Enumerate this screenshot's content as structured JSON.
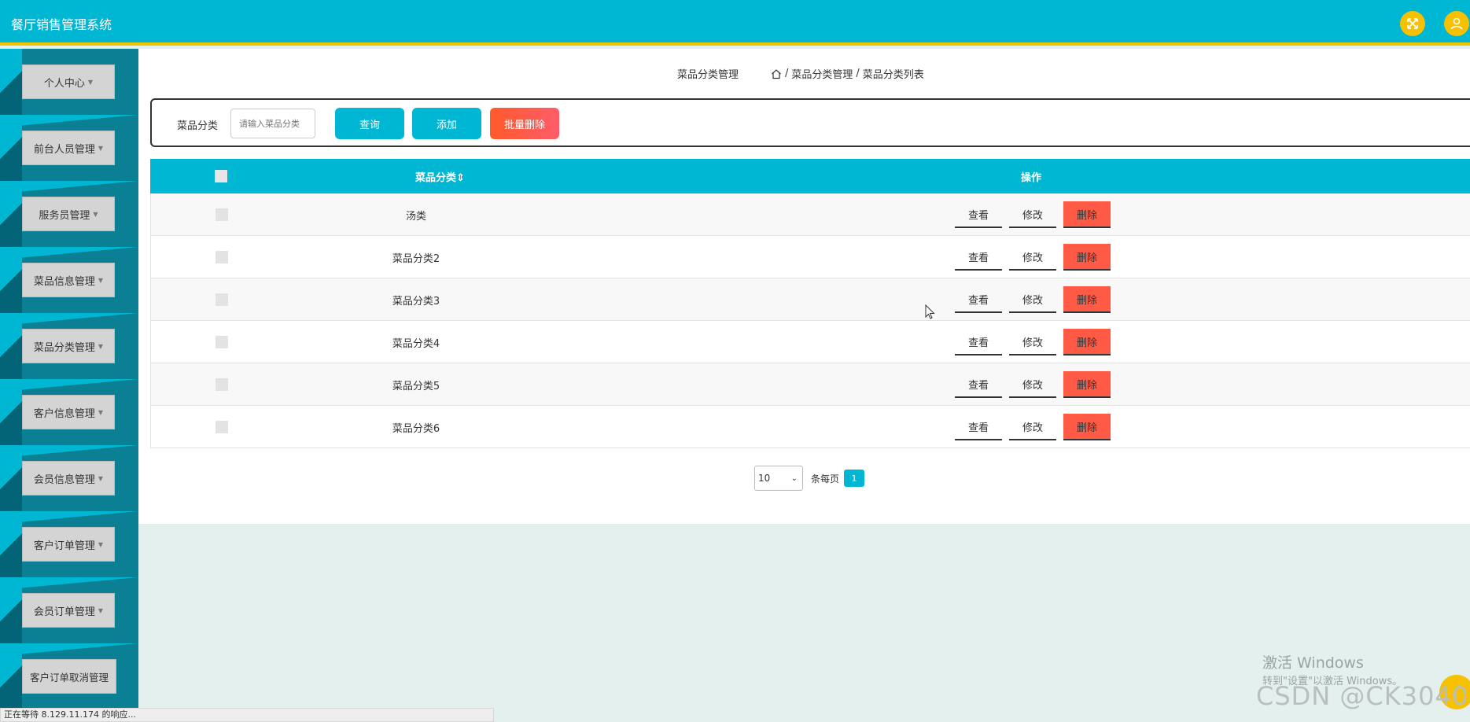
{
  "header": {
    "title": "餐厅销售管理系统",
    "accent_color": "#00b7d3",
    "border_color": "#f2c300",
    "icons": [
      "fullscreen-icon",
      "user-icon"
    ]
  },
  "sidebar": {
    "items": [
      {
        "label": "个人中心"
      },
      {
        "label": "前台人员管理"
      },
      {
        "label": "服务员管理"
      },
      {
        "label": "菜品信息管理"
      },
      {
        "label": "菜品分类管理"
      },
      {
        "label": "客户信息管理"
      },
      {
        "label": "会员信息管理"
      },
      {
        "label": "客户订单管理"
      },
      {
        "label": "会员订单管理"
      },
      {
        "label": "客户订单取消管理"
      }
    ]
  },
  "page": {
    "title": "菜品分类管理",
    "breadcrumb": [
      "菜品分类管理",
      "菜品分类列表"
    ]
  },
  "search": {
    "label": "菜品分类",
    "placeholder": "请输入菜品分类",
    "query_label": "查询",
    "add_label": "添加",
    "batch_delete_label": "批量删除"
  },
  "table": {
    "columns": [
      "菜品分类",
      "操作"
    ],
    "sort_icon": "sort-icon",
    "rows": [
      {
        "name": "汤类"
      },
      {
        "name": "菜品分类2"
      },
      {
        "name": "菜品分类3"
      },
      {
        "name": "菜品分类4"
      },
      {
        "name": "菜品分类5"
      },
      {
        "name": "菜品分类6"
      }
    ],
    "actions": {
      "view": "查看",
      "edit": "修改",
      "delete": "删除"
    }
  },
  "pagination": {
    "page_size": "10",
    "per_page_label": "条每页",
    "current_page": "1"
  },
  "statusbar": {
    "text": "正在等待 8.129.11.174 的响应..."
  },
  "watermark": {
    "activate_title": "激活 Windows",
    "activate_sub": "转到\"设置\"以激活 Windows。",
    "csdn": "CSDN @CK3040"
  }
}
